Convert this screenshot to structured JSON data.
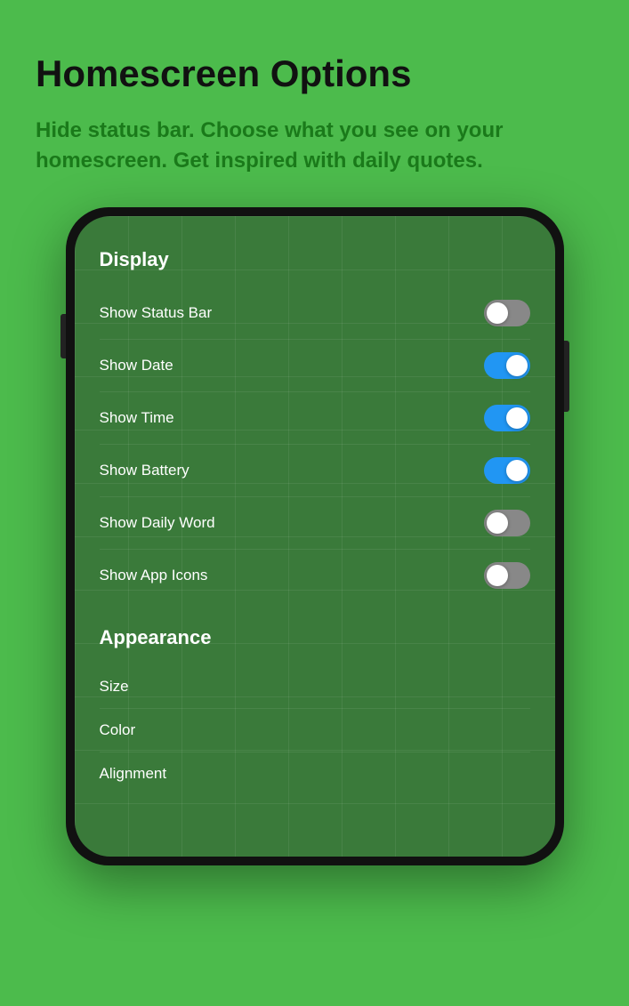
{
  "header": {
    "title": "Homescreen Options",
    "subtitle": "Hide status bar. Choose what you see on your homescreen. Get inspired with daily quotes."
  },
  "phone": {
    "display_section": {
      "label": "Display",
      "rows": [
        {
          "id": "show-status-bar",
          "label": "Show Status Bar",
          "state": "off"
        },
        {
          "id": "show-date",
          "label": "Show Date",
          "state": "on"
        },
        {
          "id": "show-time",
          "label": "Show Time",
          "state": "on"
        },
        {
          "id": "show-battery",
          "label": "Show Battery",
          "state": "on"
        },
        {
          "id": "show-daily-word",
          "label": "Show Daily Word",
          "state": "off"
        },
        {
          "id": "show-app-icons",
          "label": "Show App Icons",
          "state": "off"
        }
      ]
    },
    "appearance_section": {
      "label": "Appearance",
      "items": [
        {
          "id": "size",
          "label": "Size"
        },
        {
          "id": "color",
          "label": "Color"
        },
        {
          "id": "alignment",
          "label": "Alignment"
        }
      ]
    }
  }
}
